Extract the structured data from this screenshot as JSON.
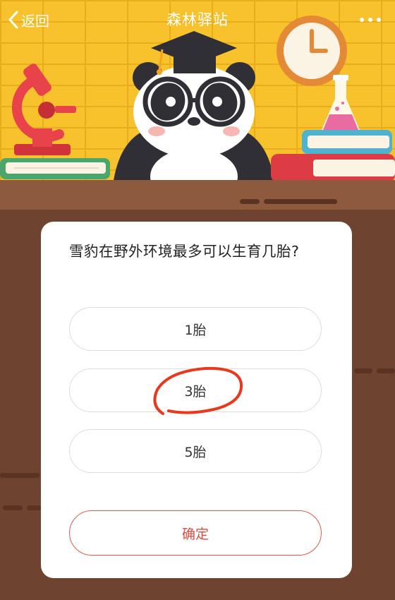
{
  "header": {
    "back_label": "返回",
    "title": "森林驿站"
  },
  "quiz": {
    "question": "雪豹在野外环境最多可以生育几胎?",
    "options": [
      {
        "label": "1胎"
      },
      {
        "label": "3胎"
      },
      {
        "label": "5胎"
      }
    ],
    "confirm_label": "确定"
  },
  "colors": {
    "wall": "#f7c22c",
    "desk": "#6e4430",
    "accent_red": "#dd4a3e",
    "annotation": "#e8391f"
  },
  "icons": [
    "chevron-left-icon",
    "more-dots-icon",
    "microscope-icon",
    "clock-icon",
    "flask-icon",
    "panda-mascot",
    "graduation-cap-icon",
    "book-stack-icon"
  ]
}
